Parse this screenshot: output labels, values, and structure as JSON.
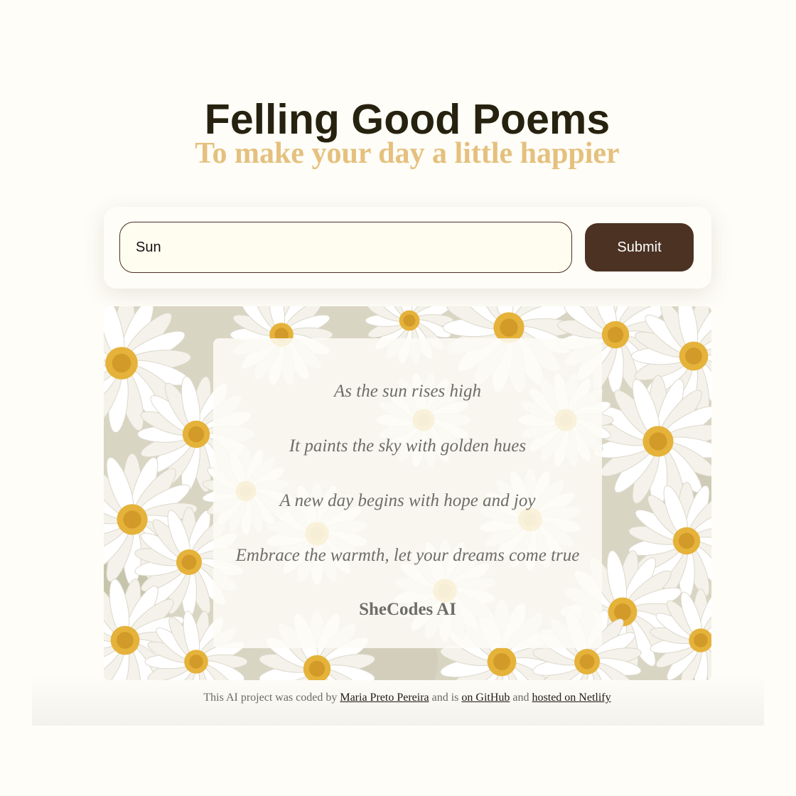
{
  "header": {
    "title": "Felling Good Poems",
    "subtitle": "To make your day a little happier"
  },
  "search": {
    "value": "Sun",
    "submit_label": "Submit"
  },
  "poem": {
    "lines": [
      "As the sun rises high",
      "It paints the sky with golden hues",
      "A new day begins with hope and joy",
      "Embrace the warmth, let your dreams come true"
    ],
    "signature": "SheCodes AI",
    "background": "daisy-flowers-image"
  },
  "footer": {
    "text_1": "This AI project was coded by",
    "author_link": "Maria Preto Pereira",
    "text_2": "and is",
    "github_link": "on GitHub",
    "text_3": "and",
    "netlify_link": "hosted on Netlify"
  },
  "colors": {
    "background": "#fefdf7",
    "title": "#26220f",
    "subtitle": "#e5c07e",
    "button": "#4b3223",
    "input_border": "#4a2f1f",
    "poem_text": "#6f6d68"
  }
}
